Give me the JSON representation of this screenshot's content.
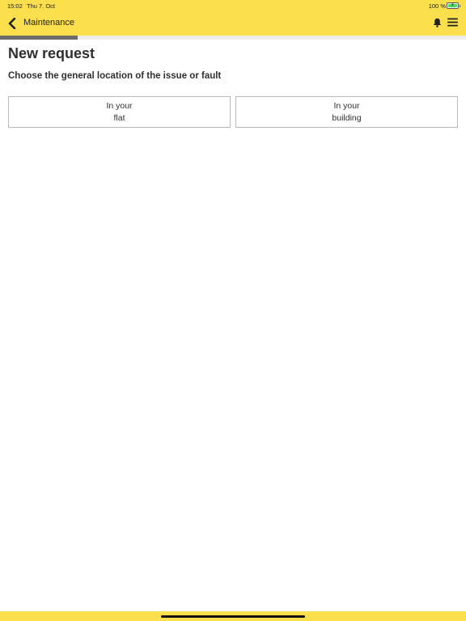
{
  "status_bar": {
    "time": "15:02",
    "date": "Thu 7. Oct",
    "battery": "100 %"
  },
  "header": {
    "title": "Maintenance",
    "back_icon": "chevron-left-icon",
    "bell_icon": "bell-icon",
    "menu_icon": "hamburger-menu-icon"
  },
  "progress": {
    "fraction": 0.167
  },
  "main": {
    "title": "New request",
    "subtitle": "Choose the general location of the issue or fault",
    "options": [
      {
        "line1": "In your",
        "line2": "flat"
      },
      {
        "line1": "In your",
        "line2": "building"
      }
    ]
  },
  "colors": {
    "brand_yellow": "#fcdf4c",
    "progress_fill": "#6b6b6b",
    "border": "#b9b9b9"
  }
}
